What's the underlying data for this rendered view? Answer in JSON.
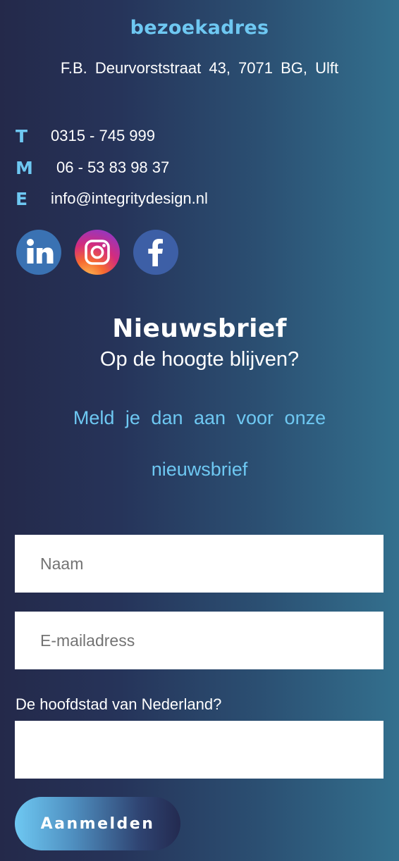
{
  "visit": {
    "title": "bezoekadres",
    "address": "F.B. Deurvorststraat 43, 7071 BG, Ulft"
  },
  "contact": [
    {
      "letter": "T",
      "value": "0315 - 745 999"
    },
    {
      "letter": "M",
      "value": "06 - 53 83 98 37"
    },
    {
      "letter": "E",
      "value": "info@integritydesign.nl"
    }
  ],
  "social": [
    {
      "icon": "linkedin-icon",
      "color": "#3a72b3"
    },
    {
      "icon": "instagram-icon",
      "color": "#d32c7d"
    },
    {
      "icon": "facebook-icon",
      "color": "#3d5fa6"
    }
  ],
  "newsletter": {
    "title": "Nieuwsbrief",
    "subtitle": "Op de hoogte blijven?",
    "text_line1": "Meld je dan aan voor onze",
    "text_line2": "nieuwsbrief"
  },
  "form": {
    "name_placeholder": "Naam",
    "email_placeholder": "E-mailadress",
    "question_label": "De hoofdstad van Nederland?",
    "answer_value": "",
    "submit_label": "Aanmelden"
  },
  "colors": {
    "accent": "#6ec8f2",
    "background_left": "#24294a",
    "background_right": "#33708e"
  }
}
